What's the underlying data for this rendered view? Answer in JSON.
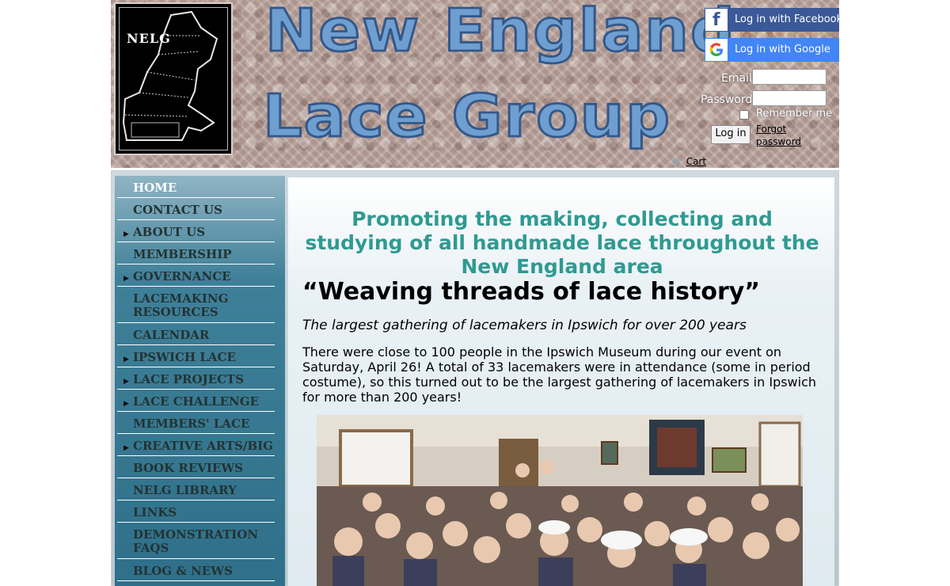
{
  "header": {
    "logo_text": "NELG",
    "title_line1": "New England",
    "title_line2": "Lace Group"
  },
  "login": {
    "facebook_label": "Log in with Facebook",
    "google_label": "Log in with Google",
    "email_label": "Email",
    "password_label": "Password",
    "remember_label": "Remember me",
    "login_button": "Log in",
    "forgot_label": "Forgot password",
    "cart_label": "Cart"
  },
  "nav": {
    "items": [
      {
        "label": "HOME",
        "arrow": false,
        "active": true
      },
      {
        "label": "CONTACT US",
        "arrow": false
      },
      {
        "label": "ABOUT US",
        "arrow": true
      },
      {
        "label": "MEMBERSHIP",
        "arrow": false
      },
      {
        "label": "GOVERNANCE",
        "arrow": true
      },
      {
        "label": "LACEMAKING RESOURCES",
        "arrow": false
      },
      {
        "label": "CALENDAR",
        "arrow": false
      },
      {
        "label": "IPSWICH LACE",
        "arrow": true
      },
      {
        "label": "LACE PROJECTS",
        "arrow": true
      },
      {
        "label": "LACE CHALLENGE",
        "arrow": true
      },
      {
        "label": "MEMBERS' LACE",
        "arrow": false
      },
      {
        "label": "CREATIVE ARTS/BIG E",
        "arrow": true
      },
      {
        "label": "BOOK REVIEWS",
        "arrow": false
      },
      {
        "label": "NELG LIBRARY",
        "arrow": false
      },
      {
        "label": "LINKS",
        "arrow": false
      },
      {
        "label": "DEMONSTRATION FAQS",
        "arrow": false
      },
      {
        "label": "BLOG & NEWS",
        "arrow": false
      }
    ]
  },
  "main": {
    "tagline": "Promoting the making, collecting and studying of all handmade lace throughout the New England area",
    "headline": "“Weaving threads of lace history”",
    "subheadline": "The largest gathering of lacemakers in Ipswich for over 200 years",
    "paragraph": "There were close to 100 people in the Ipswich Museum during our event on Saturday, April 26! A total of 33 lacemakers were in attendance (some in period costume), so this turned out to be the largest gathering of lacemakers in Ipswich for more than 200 years!"
  },
  "colors": {
    "tagline": "#2f9a92",
    "title_fill": "#6f9fd0",
    "facebook": "#3b5998",
    "google": "#4285f4",
    "sidebar": "#3f8099"
  },
  "icons": {
    "facebook": "facebook-icon",
    "google": "google-icon",
    "cart": "cart-icon",
    "nav_arrow": "triangle-right-icon"
  }
}
